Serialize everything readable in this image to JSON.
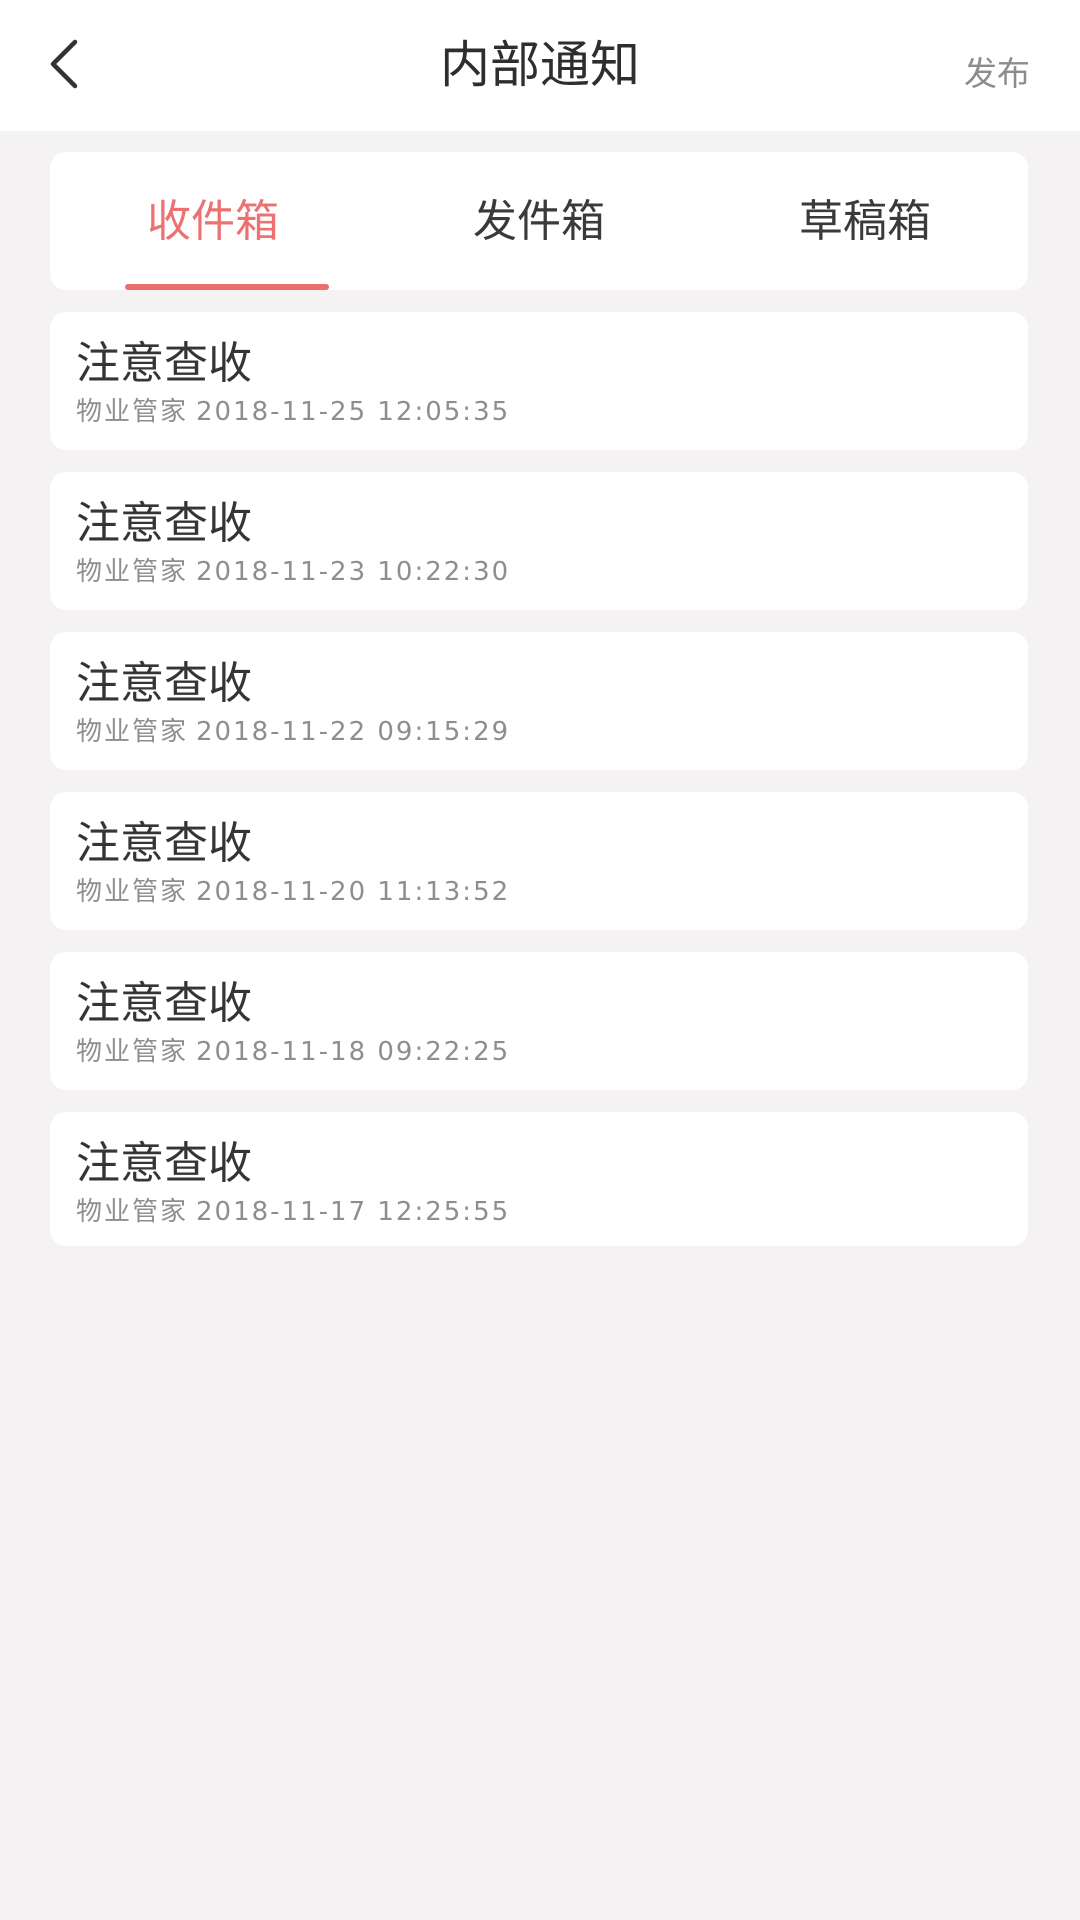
{
  "header": {
    "back_icon": "chevron-left-icon",
    "title": "内部通知",
    "action_label": "发布"
  },
  "tabs": [
    {
      "label": "收件箱",
      "active": true
    },
    {
      "label": "发件箱",
      "active": false
    },
    {
      "label": "草稿箱",
      "active": false
    }
  ],
  "colors": {
    "accent": "#ec7170",
    "background": "#f4f2f3",
    "card": "#ffffff",
    "title_text": "#353535",
    "meta_text": "#8e8e8e"
  },
  "notices": [
    {
      "title": "注意查收",
      "sender": "物业管家",
      "datetime": "2018-11-25 12:05:35"
    },
    {
      "title": "注意查收",
      "sender": "物业管家",
      "datetime": "2018-11-23 10:22:30"
    },
    {
      "title": "注意查收",
      "sender": "物业管家",
      "datetime": "2018-11-22 09:15:29"
    },
    {
      "title": "注意查收",
      "sender": "物业管家",
      "datetime": "2018-11-20 11:13:52"
    },
    {
      "title": "注意查收",
      "sender": "物业管家",
      "datetime": "2018-11-18 09:22:25"
    },
    {
      "title": "注意查收",
      "sender": "物业管家",
      "datetime": "2018-11-17 12:25:55"
    }
  ]
}
